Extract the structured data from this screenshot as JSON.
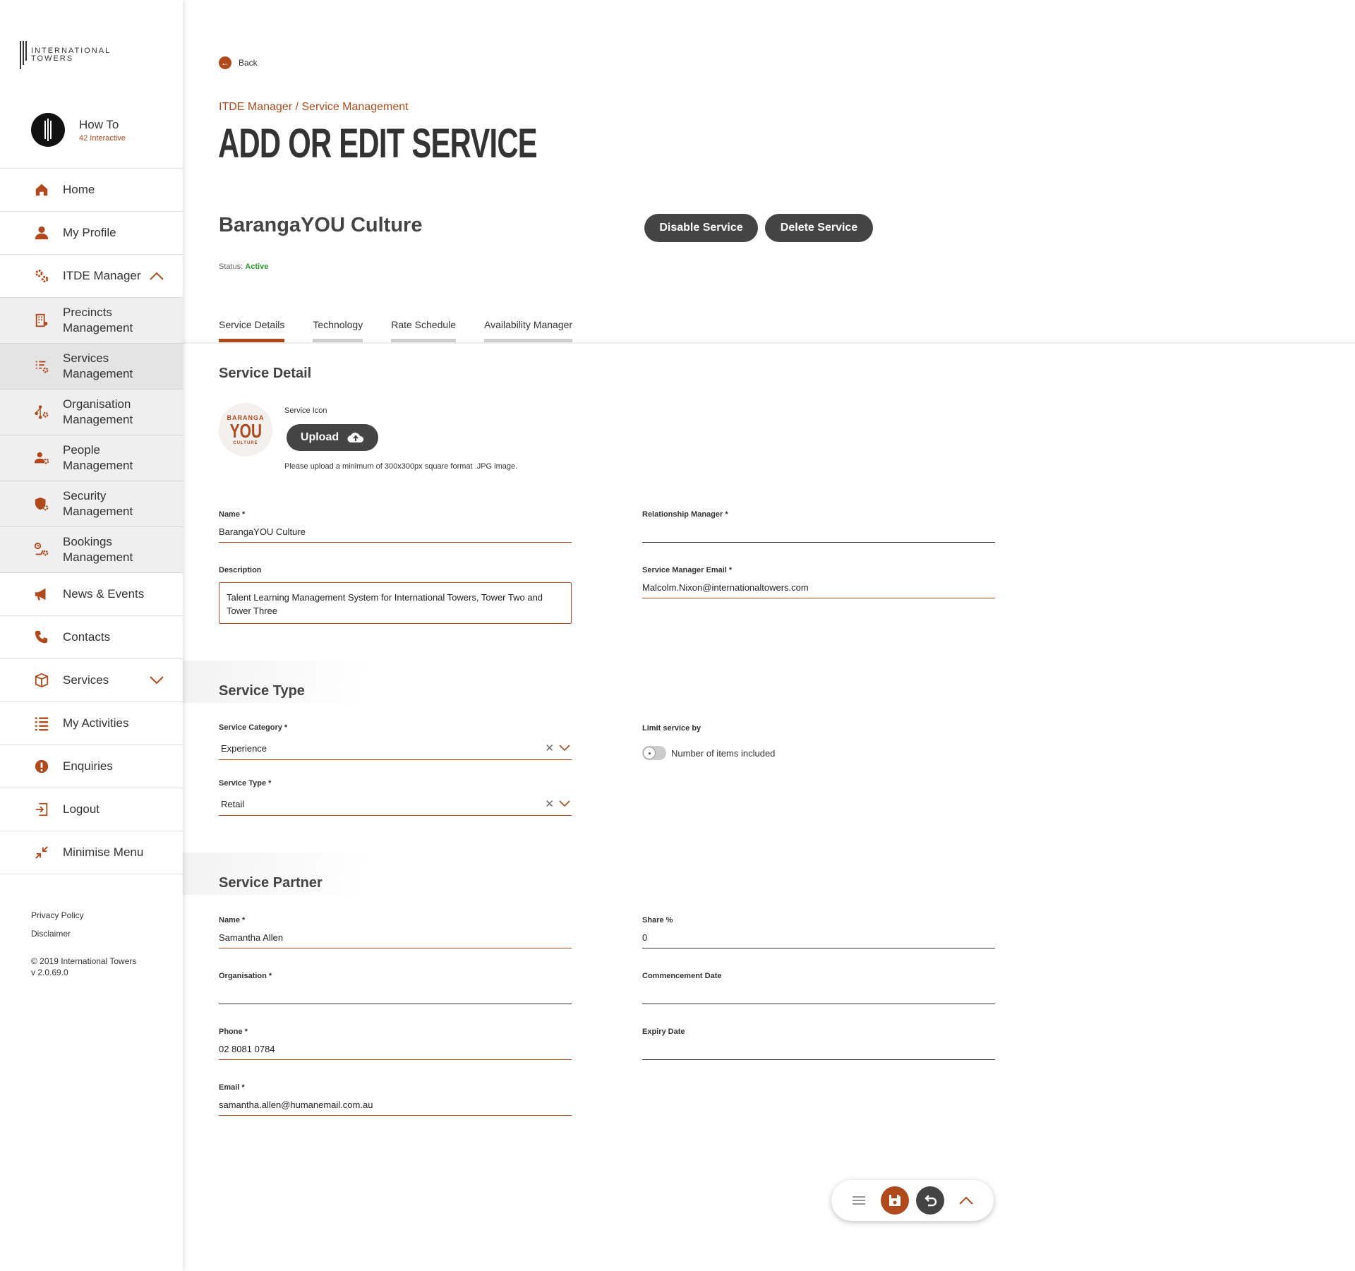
{
  "brand": {
    "logo_line1": "INTERNATIONAL",
    "logo_line2": "TOWERS",
    "accent": "#b04a1c",
    "dark": "#444444"
  },
  "user": {
    "name": "How To",
    "org": "42 Interactive"
  },
  "nav": {
    "home": "Home",
    "profile": "My Profile",
    "itde": "ITDE Manager",
    "sub": [
      "Precincts Management",
      "Services Management",
      "Organisation Management",
      "People Management",
      "Security Management",
      "Bookings Management"
    ],
    "news": "News & Events",
    "contacts": "Contacts",
    "services": "Services",
    "activities": "My Activities",
    "enquiries": "Enquiries",
    "logout": "Logout",
    "minimise": "Minimise Menu"
  },
  "footer": {
    "privacy": "Privacy Policy",
    "disclaimer": "Disclaimer",
    "copyright": "© 2019 International Towers",
    "version": "v 2.0.69.0"
  },
  "page": {
    "back": "Back",
    "breadcrumb": "ITDE Manager / Service Management",
    "title": "ADD OR EDIT SERVICE",
    "service_name": "BarangaYOU Culture",
    "disable_btn": "Disable Service",
    "delete_btn": "Delete Service",
    "status_label": "Status:",
    "status_value": "Active",
    "status_color": "#2a9a2a"
  },
  "tabs": [
    "Service Details",
    "Technology",
    "Rate Schedule",
    "Availability Manager"
  ],
  "service_detail": {
    "title": "Service Detail",
    "icon_label": "Service Icon",
    "icon_text": [
      "BARANGA",
      "YOU",
      "CULTURE"
    ],
    "upload": "Upload",
    "hint": "Please upload a minimum of 300x300px square format .JPG image.",
    "name_label": "Name *",
    "name_value": "BarangaYOU Culture",
    "rm_label": "Relationship Manager *",
    "rm_value": "",
    "desc_label": "Description",
    "desc_value": "Talent Learning Management System for International Towers, Tower Two and Tower Three",
    "email_label": "Service Manager Email *",
    "email_value": "Malcolm.Nixon@internationaltowers.com"
  },
  "service_type": {
    "title": "Service Type",
    "category_label": "Service Category *",
    "category_value": "Experience",
    "type_label": "Service Type *",
    "type_value": "Retail",
    "limit_label": "Limit service by",
    "limit_option": "Number of items included",
    "clear_glyph": "✕"
  },
  "partner": {
    "title": "Service Partner",
    "name_label": "Name *",
    "name_value": "Samantha Allen",
    "share_label": "Share %",
    "share_value": "0",
    "org_label": "Organisation *",
    "org_value": "",
    "commence_label": "Commencement Date",
    "commence_value": "",
    "phone_label": "Phone *",
    "phone_value": "02 8081 0784",
    "expiry_label": "Expiry Date",
    "expiry_value": "",
    "email_label": "Email *",
    "email_value": "samantha.allen@humanemail.com.au"
  }
}
